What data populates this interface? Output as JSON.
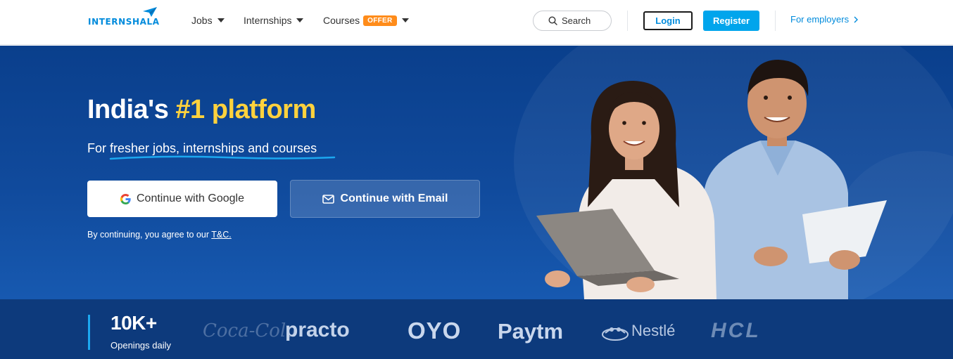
{
  "header": {
    "logo": {
      "part1": "INTERN",
      "part2": "SHALA"
    },
    "nav": [
      {
        "label": "Jobs"
      },
      {
        "label": "Internships"
      },
      {
        "label": "Courses",
        "badge": "OFFER"
      }
    ],
    "search": {
      "label": "Search"
    },
    "login_label": "Login",
    "register_label": "Register",
    "employers_label": "For employers"
  },
  "hero": {
    "title_prefix": "India's ",
    "title_highlight": "#1 platform",
    "subtitle_prefix": "For ",
    "subtitle_underlined": "fresher jobs, internships and courses",
    "google_button": "Continue with Google",
    "email_button": "Continue with Email",
    "terms_prefix": "By continuing, you agree to our ",
    "terms_link": "T&C."
  },
  "stats": {
    "value": "10K+",
    "label": "Openings daily"
  },
  "brands": [
    "Coca-Cola",
    "practo",
    "OYO",
    "Paytm",
    "Nestlé",
    "HCL"
  ],
  "colors": {
    "brand_blue": "#008bdc",
    "register_bg": "#00a5ec",
    "hero_bg": "#0a3f8c",
    "highlight_yellow": "#ffd23d",
    "offer_orange": "#ff8c1a",
    "strip_bg": "#0d3a7c"
  }
}
